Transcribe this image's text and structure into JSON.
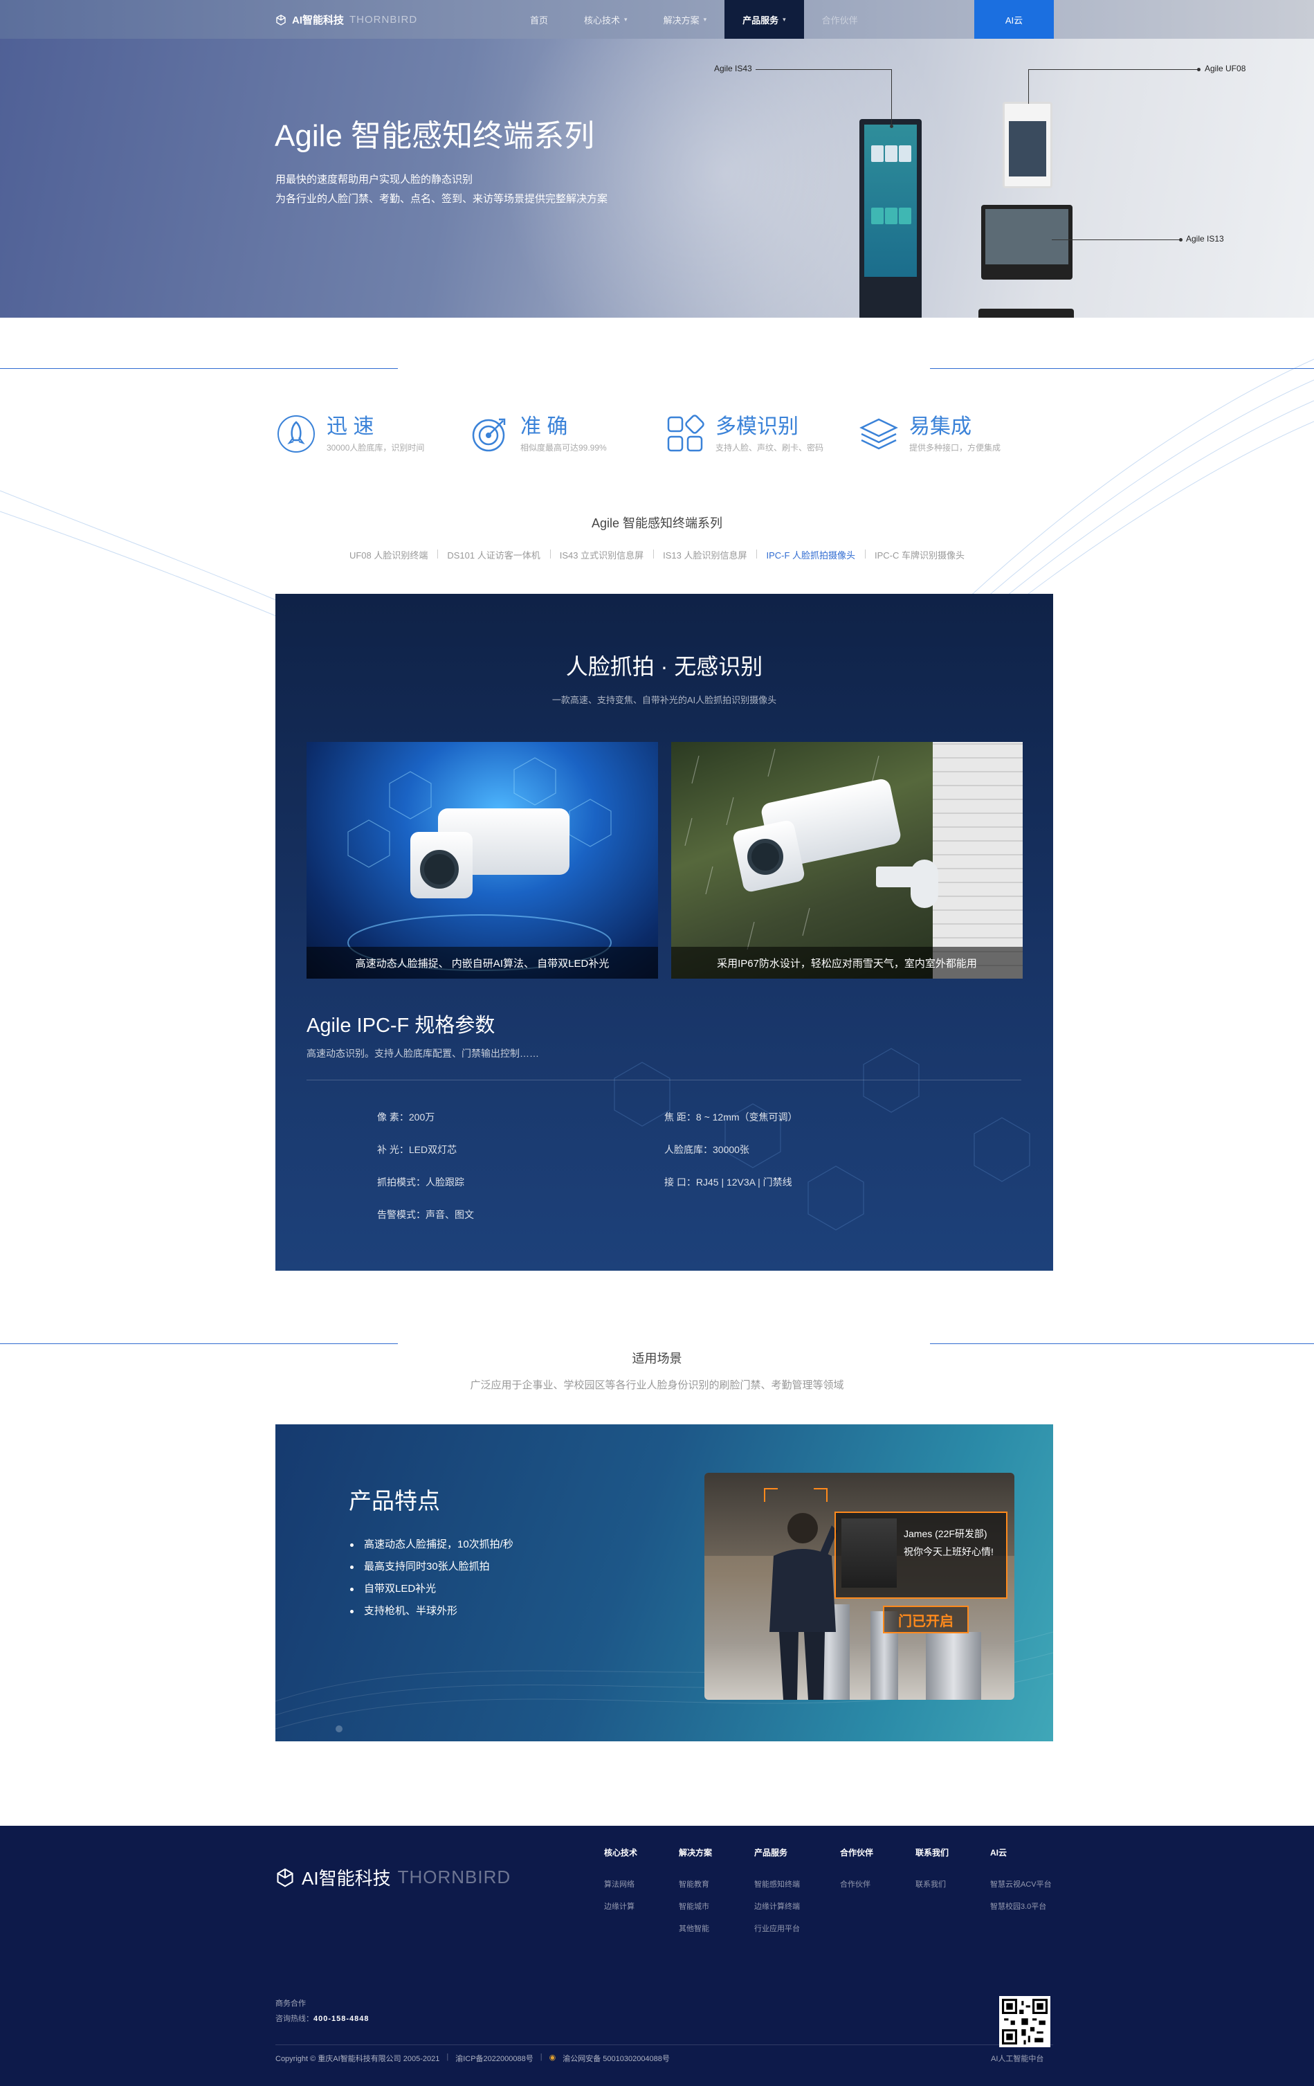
{
  "nav": {
    "logo_cn": "AI智能科技",
    "logo_en": "THORNBIRD",
    "items": [
      {
        "label": "首页"
      },
      {
        "label": "核心技术"
      },
      {
        "label": "解决方案"
      },
      {
        "label": "产品服务"
      },
      {
        "label": "合作伙伴"
      }
    ],
    "active_index": 3,
    "cloud": "AI云"
  },
  "hero": {
    "title": "Agile 智能感知终端系列",
    "line1": "用最快的速度帮助用户实现人脸的静态识别",
    "line2": "为各行业的人脸门禁、考勤、点名、签到、来访等场景提供完整解决方案",
    "callouts": {
      "is43": "Agile IS43",
      "uf08": "Agile  UF08",
      "is13": "Agile IS13"
    }
  },
  "features": [
    {
      "title": "迅 速",
      "desc": "30000人脸底库，识别时间",
      "icon": "rocket-icon"
    },
    {
      "title": "准 确",
      "desc": "相似度最高可达99.99%",
      "icon": "target-icon"
    },
    {
      "title": "多模识别",
      "desc": "支持人脸、声纹、刷卡、密码",
      "icon": "grid-icon"
    },
    {
      "title": "易集成",
      "desc": "提供多种接口，方便集成",
      "icon": "layers-icon"
    }
  ],
  "series": {
    "title": "Agile 智能感知终端系列",
    "tabs": [
      "UF08 人脸识别终端",
      "DS101 人证访客一体机",
      "IS43 立式识别信息屏",
      "IS13 人脸识别信息屏",
      "IPC-F 人脸抓拍摄像头",
      "IPC-C 车牌识别摄像头"
    ],
    "active_tab": 4
  },
  "product": {
    "title": "人脸抓拍 · 无感识别",
    "subtitle": "一款高速、支持变焦、自带补光的AI人脸抓拍识别摄像头",
    "photo_a_caption": "高速动态人脸捕捉、 内嵌自研AI算法、 自带双LED补光",
    "photo_b_caption": "采用IP67防水设计，轻松应对雨雪天气，室内室外都能用",
    "spec_title": "Agile IPC-F 规格参数",
    "spec_sub": "高速动态识别。支持人脸底库配置、门禁输出控制……",
    "specs_left": [
      {
        "label": "像 素",
        "value": "200万"
      },
      {
        "label": "补 光",
        "value": "LED双灯芯"
      },
      {
        "label": "抓拍模式",
        "value": "人脸跟踪"
      },
      {
        "label": "告警模式",
        "value": "声音、图文"
      }
    ],
    "specs_right": [
      {
        "label": "焦 距",
        "value": "8 ~ 12mm（变焦可调）"
      },
      {
        "label": "人脸底库",
        "value": "30000张"
      },
      {
        "label": "接 口",
        "value": "RJ45 | 12V3A | 门禁线"
      }
    ]
  },
  "scenes": {
    "title": "适用场景",
    "subtitle": "广泛应用于企事业、学校园区等各行业人脸身份识别的刷脸门禁、考勤管理等领域"
  },
  "feature_panel": {
    "title": "产品特点",
    "bullets": [
      "高速动态人脸捕捉，10次抓拍/秒",
      "最高支持同时30张人脸抓拍",
      "自带双LED补光",
      "支持枪机、半球外形"
    ],
    "hud_name": "James (22F研发部)",
    "hud_greet": "祝你今天上班好心情!",
    "door": "门已开启"
  },
  "footer": {
    "logo_cn": "AI智能科技",
    "logo_en": "THORNBIRD",
    "columns": [
      {
        "title": "核心技术",
        "links": [
          "算法网络",
          "边缘计算"
        ]
      },
      {
        "title": "解决方案",
        "links": [
          "智能教育",
          "智能城市",
          "其他智能"
        ]
      },
      {
        "title": "产品服务",
        "links": [
          "智能感知终端",
          "边缘计算终端",
          "行业应用平台"
        ]
      },
      {
        "title": "合作伙伴",
        "links": [
          "合作伙伴"
        ]
      },
      {
        "title": "联系我们",
        "links": [
          "联系我们"
        ]
      },
      {
        "title": "AI云",
        "links": [
          "智慧云视ACV平台",
          "智慧校园3.0平台"
        ]
      }
    ],
    "biz_label": "商务合作",
    "hotline_label": "咨询热线",
    "hotline": "400-158-4848",
    "copyright": "Copyright © 重庆AI智能科技有限公司 2005-2021",
    "icp": "渝ICP备2022000088号",
    "police": "渝公网安备 50010302004088号",
    "qr_caption": "AI人工智能中台"
  },
  "colors": {
    "accent": "#2f6bd1",
    "nav_active": "#0f1d3d",
    "cloud": "#1b6fe0",
    "footer": "#0d1a4a",
    "orange": "#ff8a1c"
  }
}
